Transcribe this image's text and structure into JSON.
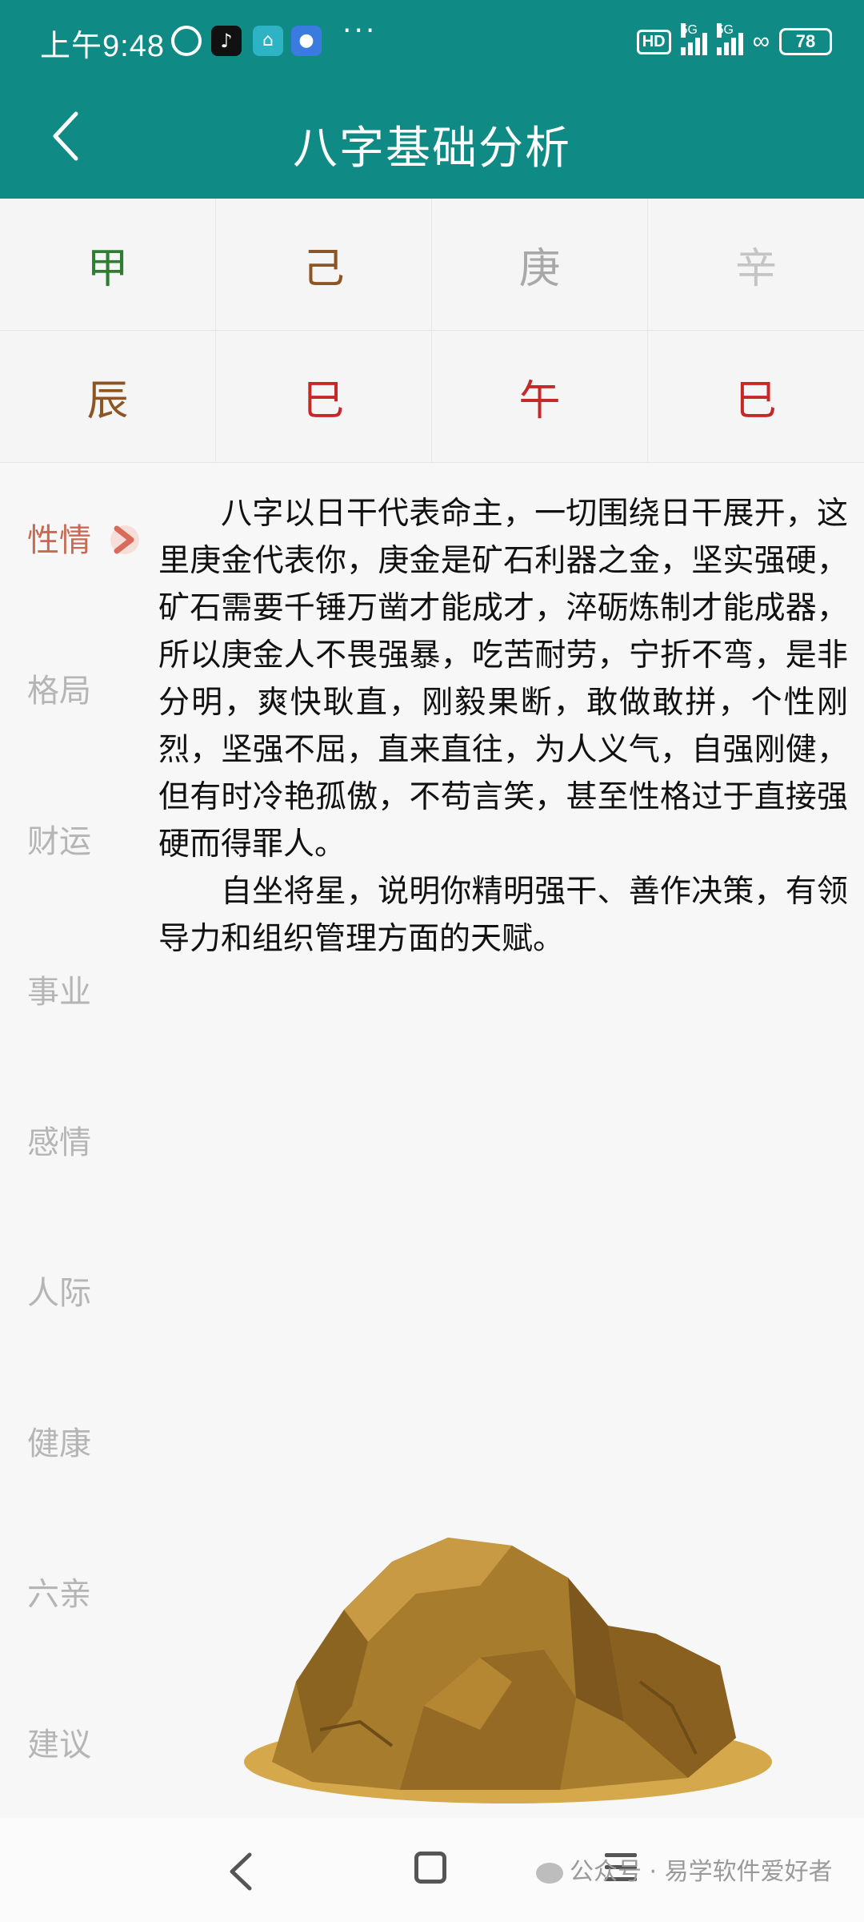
{
  "status_bar": {
    "time": "上午9:48",
    "more": "···",
    "hd_label": "HD",
    "signal1_label": "5G",
    "signal2_label": "5G",
    "battery": "78"
  },
  "header": {
    "title": "八字基础分析"
  },
  "pillars": {
    "stems": [
      {
        "char": "甲",
        "color": "#2e7d32"
      },
      {
        "char": "己",
        "color": "#8d5524"
      },
      {
        "char": "庚",
        "color": "#a8a8a8"
      },
      {
        "char": "辛",
        "color": "#c4c4c4"
      }
    ],
    "branches": [
      {
        "char": "辰",
        "color": "#8d5524"
      },
      {
        "char": "巳",
        "color": "#c62828"
      },
      {
        "char": "午",
        "color": "#c62828"
      },
      {
        "char": "巳",
        "color": "#c62828"
      }
    ]
  },
  "side_menu": {
    "items": [
      "性情",
      "格局",
      "财运",
      "事业",
      "感情",
      "人际",
      "健康",
      "六亲",
      "建议"
    ],
    "active": "性情"
  },
  "content": {
    "paragraphs": [
      "八字以日干代表命主，一切围绕日干展开，这里庚金代表你，庚金是矿石利器之金，坚实强硬，矿石需要千锤万凿才能成才，淬砺炼制才能成器，所以庚金人不畏强暴，吃苦耐劳，宁折不弯，是非分明，爽快耿直，刚毅果断，敢做敢拼，个性刚烈，坚强不屈，直来直往，为人义气，自强刚健，但有时冷艳孤傲，不苟言笑，甚至性格过于直接强硬而得罪人。",
      "自坐将星，说明你精明强干、善作决策，有领导力和组织管理方面的天赋。"
    ]
  },
  "watermark": {
    "text": "公众号 · 易学软件爱好者"
  },
  "colors": {
    "header_bg": "#0f8a84",
    "active_menu": "#c66a55",
    "inactive_menu": "#b5b5b5",
    "rock": "#a77c2c"
  }
}
